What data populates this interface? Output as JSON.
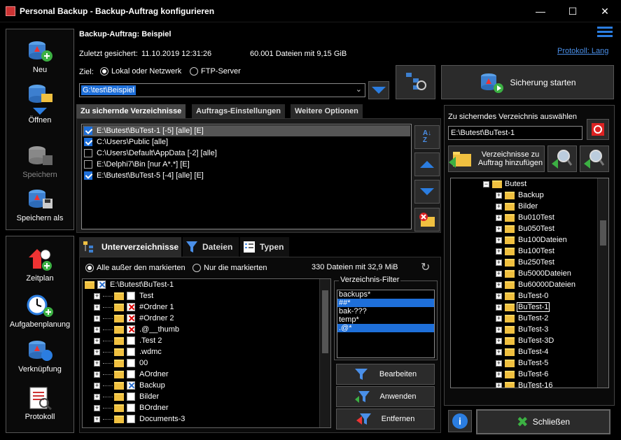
{
  "window": {
    "title": "Personal Backup - Backup-Auftrag konfigurieren",
    "minimize": "—",
    "maximize": "☐",
    "close": "✕"
  },
  "sidebar": {
    "top": [
      {
        "label": "Neu",
        "icon": "db-add-icon"
      },
      {
        "label": "Öffnen",
        "icon": "db-open-icon"
      },
      {
        "label": "Speichern",
        "icon": "db-save-icon",
        "disabled": true
      },
      {
        "label": "Speichern als",
        "icon": "db-save-as-icon"
      }
    ],
    "bottom": [
      {
        "label": "Zeitplan",
        "icon": "schedule-icon"
      },
      {
        "label": "Aufgabenplanung",
        "icon": "task-scheduler-icon"
      },
      {
        "label": "Verknüpfung",
        "icon": "shortcut-icon"
      },
      {
        "label": "Protokoll",
        "icon": "log-icon"
      }
    ]
  },
  "header": {
    "job_title": "Backup-Auftrag: Beispiel",
    "last_saved_label": "Zuletzt gesichert:",
    "last_saved_value": "11.10.2019 12:31:26",
    "files_info": "60.001 Dateien mit 9,15 GiB",
    "protocol_link": "Protokoll: Lang"
  },
  "target": {
    "label": "Ziel:",
    "option_local": "Lokal oder Netzwerk",
    "option_ftp": "FTP-Server",
    "selected": "local",
    "path": "G:\\test\\Beispiel"
  },
  "start_button": "Sicherung starten",
  "main_tabs": [
    "Zu sichernde Verzeichnisse",
    "Auftrags-Einstellungen",
    "Weitere Optionen"
  ],
  "directories": [
    {
      "path": "E:\\Butest\\BuTest-1 [-5] [alle] [E]",
      "checked": true,
      "selected": true
    },
    {
      "path": "C:\\Users\\Public [alle]",
      "checked": true
    },
    {
      "path": "C:\\Users\\Default\\AppData [-2] [alle]",
      "checked": false
    },
    {
      "path": "E:\\Delphi7\\Bin [nur A*.*] [E]",
      "checked": false
    },
    {
      "path": "E:\\Butest\\BuTest-5 [-4] [alle] [E]",
      "checked": true
    }
  ],
  "sub_tabs": [
    "Unterverzeichnisse",
    "Dateien",
    "Typen"
  ],
  "subdir": {
    "option_all_except": "Alle außer den markierten",
    "option_only": "Nur die markierten",
    "summary": "330 Dateien mit 32,9 MiB",
    "root": "E:\\Butest\\BuTest-1",
    "items": [
      {
        "name": "Test",
        "mark": "none"
      },
      {
        "name": "#Ordner 1",
        "mark": "red"
      },
      {
        "name": "#Ordner 2",
        "mark": "red"
      },
      {
        "name": ".@__thumb",
        "mark": "red"
      },
      {
        "name": ".Test 2",
        "mark": "none"
      },
      {
        "name": ".wdmc",
        "mark": "none"
      },
      {
        "name": "00",
        "mark": "none"
      },
      {
        "name": "AOrdner",
        "mark": "none"
      },
      {
        "name": "Backup",
        "mark": "blue"
      },
      {
        "name": "Bilder",
        "mark": "none"
      },
      {
        "name": "BOrdner",
        "mark": "none"
      },
      {
        "name": "Documents-3",
        "mark": "none"
      }
    ]
  },
  "filter": {
    "title": "Verzeichnis-Filter",
    "items": [
      {
        "text": "backups*",
        "selected": false
      },
      {
        "text": "##*",
        "selected": true
      },
      {
        "text": "bak-???",
        "selected": false
      },
      {
        "text": "temp*",
        "selected": false
      },
      {
        "text": ".@*",
        "selected": true
      }
    ],
    "edit": "Bearbeiten",
    "apply": "Anwenden",
    "remove": "Entfernen"
  },
  "right": {
    "select_label": "Zu sicherndes Verzeichnis auswählen",
    "selected_path": "E:\\Butest\\BuTest-1",
    "add_button": "Verzeichnisse zu Auftrag hinzufügen",
    "tree_root": "Butest",
    "tree_items": [
      "Backup",
      "Bilder",
      "Bu010Test",
      "Bu050Test",
      "Bu100Dateien",
      "Bu100Test",
      "Bu250Test",
      "Bu5000Dateien",
      "Bu60000Dateien",
      "BuTest-0",
      "BuTest-1",
      "BuTest-2",
      "BuTest-3",
      "BuTest-3D",
      "BuTest-4",
      "BuTest-5",
      "BuTest-6",
      "BuTest-16"
    ],
    "tree_selected": "BuTest-1"
  },
  "close_button": "Schließen",
  "info_icon": "i"
}
